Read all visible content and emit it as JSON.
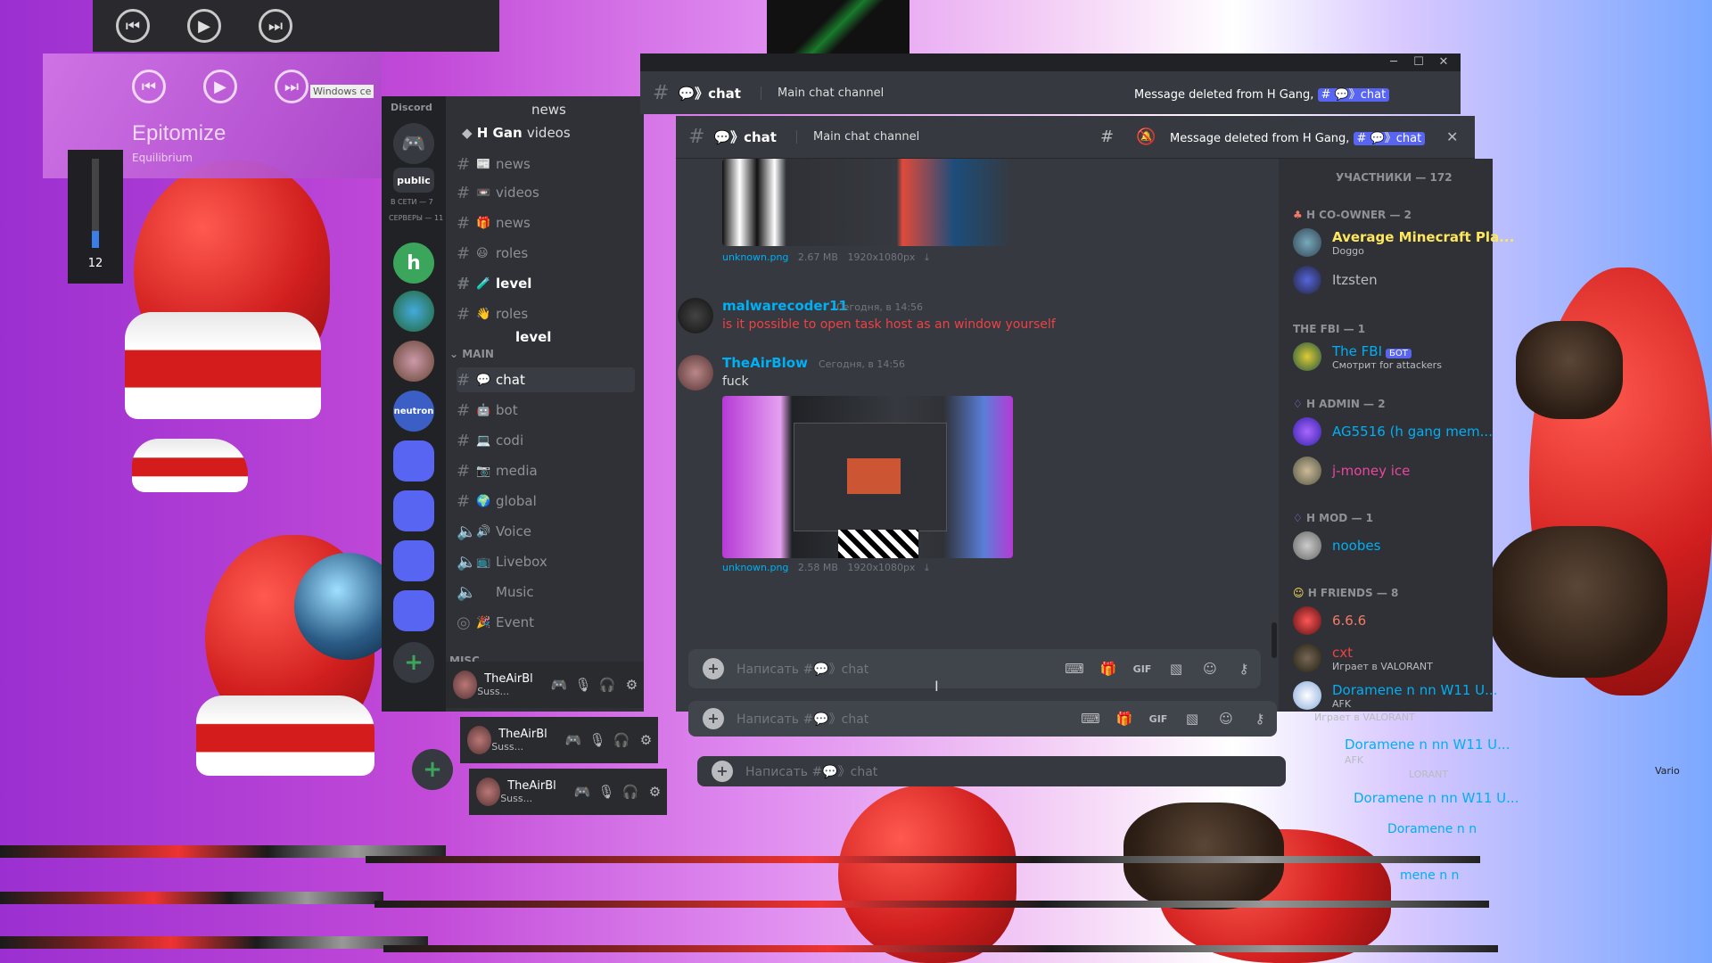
{
  "player": {
    "title": "Epitomize",
    "artist": "Equilibrium",
    "volume": "12",
    "volume_level": 0.12,
    "prev_label": "⏮",
    "play_label": "▶",
    "next_label": "⏭",
    "side_label": "Windows ce"
  },
  "discord": {
    "brand": "Discord",
    "server_name": "H Gan",
    "rail": {
      "public_label": "public",
      "online_label": "В СЕТИ — 7",
      "servers_label": "СЕРВЕРЫ — 11",
      "neutron_label": "neutron",
      "add_label": "+"
    },
    "channels_top": [
      {
        "emoji": "📰",
        "name": "news"
      },
      {
        "emoji": "📼",
        "name": "videos"
      },
      {
        "emoji": "🎁",
        "name": "news"
      },
      {
        "emoji": "😃",
        "name": "roles"
      },
      {
        "emoji": "🧪",
        "name": "level"
      },
      {
        "emoji": "👋",
        "name": "roles"
      }
    ],
    "extra_channel": "level",
    "back_channels": [
      "news",
      "videos"
    ],
    "category_main": "MAIN",
    "category_misc": "MISC",
    "channels_main": [
      {
        "emoji": "💬",
        "name": "chat",
        "type": "text"
      },
      {
        "emoji": "🤖",
        "name": "bot",
        "type": "text"
      },
      {
        "emoji": "💻",
        "name": "codi",
        "type": "text"
      },
      {
        "emoji": "📷",
        "name": "media",
        "type": "text"
      },
      {
        "emoji": "🌍",
        "name": "global",
        "type": "text"
      },
      {
        "emoji": "🔊",
        "name": "Voice",
        "type": "voice"
      },
      {
        "emoji": "📺",
        "name": "Livebox",
        "type": "voice"
      },
      {
        "emoji": "",
        "name": "Music",
        "type": "voice"
      },
      {
        "emoji": "🎉",
        "name": "Event",
        "type": "stage"
      }
    ],
    "user": {
      "name": "TheAirBl",
      "status": "Suss..."
    },
    "header": {
      "channel": "💬》chat",
      "topic": "Main chat channel",
      "toast_prefix": "Message deleted from H Gang,",
      "toast_channel": "# 💬》chat"
    },
    "messages": [
      {
        "author": "malwarecoder11",
        "time": "Сегодня, в 14:56",
        "text": "is it possible to open task host as an window yourself",
        "author_color": "#00aff4",
        "text_color": "#ed4245"
      },
      {
        "author": "TheAirBlow",
        "time": "Сегодня, в 14:56",
        "text": "fuck",
        "author_color": "#00aff4",
        "text_color": "#dcddde"
      }
    ],
    "attachments": [
      {
        "name": "unknown.png",
        "size": "2.67 MB",
        "dims": "1920x1080px"
      },
      {
        "name": "unknown.png",
        "size": "2.58 MB",
        "dims": "1920x1080px"
      }
    ],
    "input_placeholder": "Написать #💬》chat",
    "input_placeholder_back": "Написать #💬》chat",
    "gif_label": "GIF",
    "members": {
      "title": "УЧАСТНИКИ — 172",
      "groups": [
        {
          "name": "H CO-OWNER — 2",
          "color": "#f47b67",
          "members": [
            {
              "name": "Average Minecraft Pla...",
              "status": "Doggo",
              "color": "#fee75c"
            },
            {
              "name": "Itzsten",
              "status": "",
              "color": "#b9bbbe"
            }
          ]
        },
        {
          "name": "THE FBI — 1",
          "color": "#8e9297",
          "members": [
            {
              "name": "The FBI",
              "status": "Смотрит for attackers",
              "color": "#00aff4",
              "bot": "БОТ"
            }
          ]
        },
        {
          "name": "H ADMIN — 2",
          "color": "#9b84ec",
          "members": [
            {
              "name": "AG5516 (h gang mem...",
              "status": "",
              "color": "#00aff4"
            },
            {
              "name": "j-money ice",
              "status": "",
              "color": "#eb459e"
            }
          ]
        },
        {
          "name": "H MOD — 1",
          "color": "#9b84ec",
          "members": [
            {
              "name": "noobes",
              "status": "",
              "color": "#00aff4"
            }
          ]
        },
        {
          "name": "H FRIENDS — 8",
          "color": "#fee75c",
          "members": [
            {
              "name": "6.6.6",
              "status": "",
              "color": "#f47b67"
            },
            {
              "name": "cxt",
              "status": "Играет в VALORANT",
              "color": "#ed4245"
            },
            {
              "name": "Doramene n nn W11 U...",
              "status": "AFK",
              "color": "#00aff4"
            }
          ]
        }
      ],
      "echo_status_1": "Играет в VALORANT",
      "echo_name": "Doramene n nn W11 U...",
      "echo_status_2": "AFK",
      "echo_status_3": "LORANT",
      "echo_name_2": "Doramene n nn W11 U...",
      "echo_name_3": "Doramene n n",
      "echo_name_4": "mene n n",
      "echo_side": "Vario"
    }
  }
}
